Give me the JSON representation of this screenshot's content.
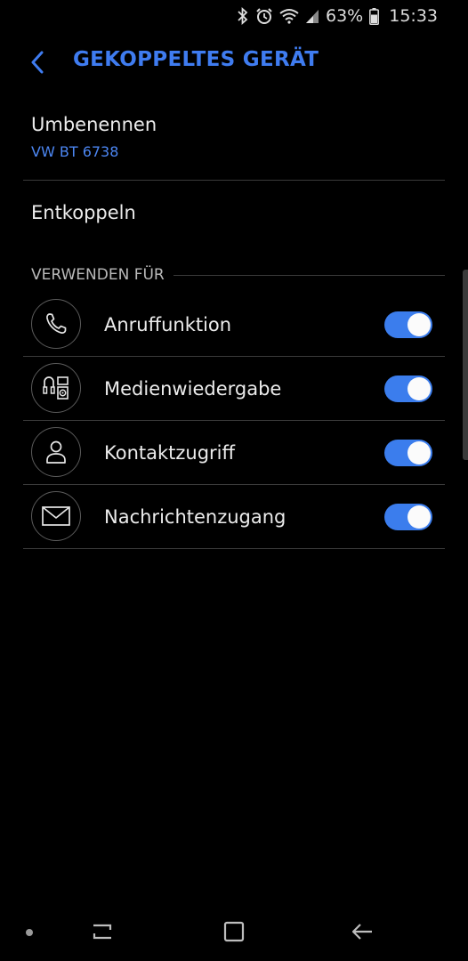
{
  "status_bar": {
    "battery_percent": "63%",
    "time": "15:33",
    "icons": [
      "bluetooth-icon",
      "alarm-icon",
      "wifi-icon",
      "signal-icon",
      "battery-icon"
    ]
  },
  "header": {
    "title": "GEKOPPELTES GERÄT",
    "back_icon": "chevron-left-icon",
    "accent_color": "#3f7cf0"
  },
  "rename": {
    "label": "Umbenennen",
    "value": "VW BT 6738"
  },
  "unpair": {
    "label": "Entkoppeln"
  },
  "section": {
    "label": "VERWENDEN FÜR"
  },
  "profiles": [
    {
      "label": "Anruffunktion",
      "icon": "phone-icon",
      "enabled": true
    },
    {
      "label": "Medienwiedergabe",
      "icon": "media-icon",
      "enabled": true
    },
    {
      "label": "Kontaktzugriff",
      "icon": "contact-icon",
      "enabled": true
    },
    {
      "label": "Nachrichtenzugang",
      "icon": "message-icon",
      "enabled": true
    }
  ],
  "nav_bar": {
    "icons": [
      "recents-icon",
      "home-icon",
      "back-icon"
    ]
  },
  "colors": {
    "background": "#000000",
    "toggle_on": "#3b7ded",
    "secondary_text": "#4c86f2"
  }
}
